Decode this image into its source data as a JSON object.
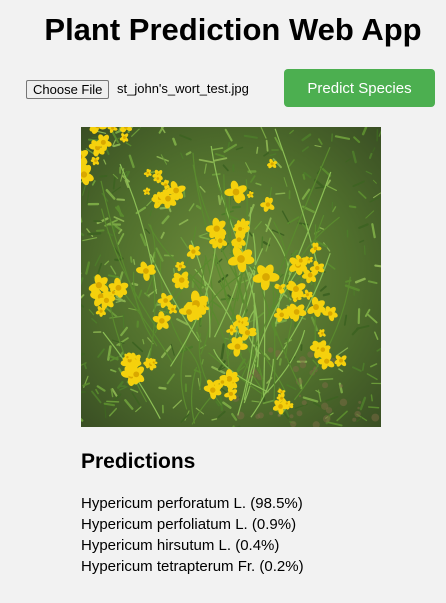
{
  "app": {
    "title": "Plant Prediction Web App"
  },
  "upload": {
    "choose_label": "Choose File",
    "file_name": "st_john's_wort_test.jpg",
    "predict_label": "Predict Species"
  },
  "colors": {
    "background": "#f2f2f2",
    "accent": "#4caf50",
    "flower": "#f5d10d",
    "foliage": "#5a8a2e"
  },
  "photo": {
    "alt": "st_john's_wort_test.jpg"
  },
  "predictions": {
    "heading": "Predictions",
    "items": [
      {
        "text": "Hypericum perforatum L. (98.5%)"
      },
      {
        "text": "Hypericum perfoliatum L. (0.9%)"
      },
      {
        "text": "Hypericum hirsutum L. (0.4%)"
      },
      {
        "text": "Hypericum tetrapterum Fr. (0.2%)"
      }
    ]
  }
}
